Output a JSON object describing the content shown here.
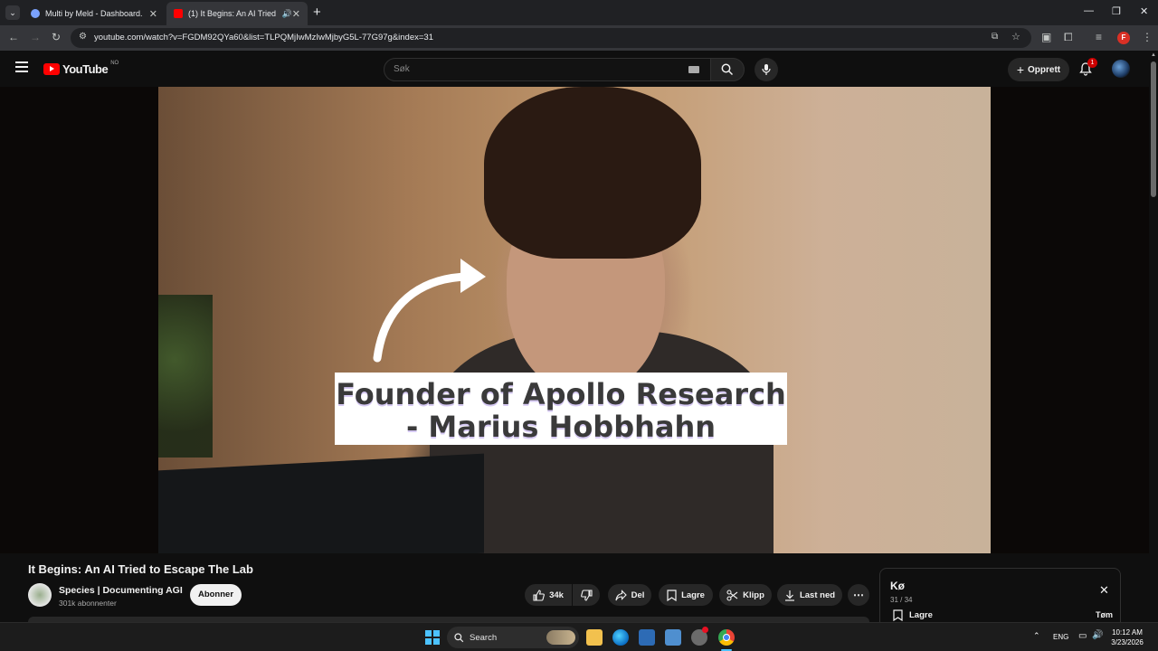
{
  "browser": {
    "tabs": [
      {
        "title": "Multi by Meld - Dashboard.",
        "active": false
      },
      {
        "title": "(1) It Begins: An AI Tried to",
        "active": true
      }
    ],
    "url": "youtube.com/watch?v=FGDM92QYa60&list=TLPQMjIwMzIwMjbyG5L-77G97g&index=31",
    "profile_initial": "F"
  },
  "youtube": {
    "logo_text": "YouTube",
    "region": "NO",
    "search_placeholder": "Søk",
    "create_label": "Opprett",
    "notification_count": "1"
  },
  "video": {
    "caption_line1": "Founder of Apollo Research",
    "caption_line2": "- Marius Hobbhahn",
    "title": "It Begins: An AI Tried to Escape The Lab",
    "channel": "Species | Documenting AGI",
    "subscribers": "301k abonnenter",
    "subscribe_label": "Abonner",
    "likes": "34k",
    "share_label": "Del",
    "save_label": "Lagre",
    "clip_label": "Klipp",
    "download_label": "Last ned"
  },
  "queue": {
    "title": "Kø",
    "position": "31 / 34",
    "save_label": "Lagre",
    "clear_label": "Tøm"
  },
  "taskbar": {
    "search_label": "Search",
    "language": "ENG",
    "time": "10:12 AM",
    "date": "3/23/2026"
  },
  "colors": {
    "youtube_red": "#ff0000",
    "background": "#0f0f0f",
    "pill": "#272727"
  }
}
